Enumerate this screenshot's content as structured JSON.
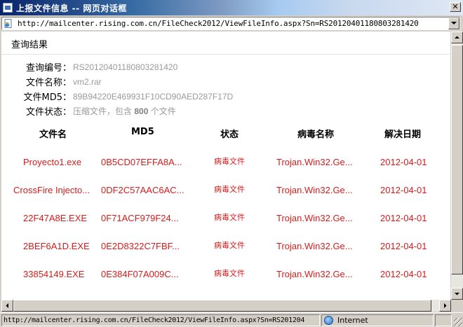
{
  "window": {
    "title": "上报文件信息 -- 网页对话框"
  },
  "address": {
    "url": "http://mailcenter.rising.com.cn/FileCheck2012/ViewFileInfo.aspx?Sn=RS20120401180803281420"
  },
  "page": {
    "section_title": "查询结果",
    "info": [
      {
        "label": "查询编号：",
        "value": "RS20120401180803281420"
      },
      {
        "label": "文件名称：",
        "value": "vm2.rar"
      },
      {
        "label": "文件MD5：",
        "value": "89B94220E469931F10CD90AED287F17D"
      },
      {
        "label": "文件状态：",
        "value_prefix": "压缩文件，包含 ",
        "value_count": "800",
        "value_suffix": " 个文件"
      }
    ],
    "table": {
      "headers": [
        "文件名",
        "MD5",
        "状态",
        "病毒名称",
        "解决日期"
      ],
      "rows": [
        {
          "file": "Proyecto1.exe",
          "md5": "0B5CD07EFFA8A...",
          "status": "病毒文件",
          "virus": "Trojan.Win32.Ge...",
          "date": "2012-04-01"
        },
        {
          "file": "CrossFire Injecto...",
          "md5": "0DF2C57AAC6AC...",
          "status": "病毒文件",
          "virus": "Trojan.Win32.Ge...",
          "date": "2012-04-01"
        },
        {
          "file": "22F47A8E.EXE",
          "md5": "0F71ACF979F24...",
          "status": "病毒文件",
          "virus": "Trojan.Win32.Ge...",
          "date": "2012-04-01"
        },
        {
          "file": "2BEF6A1D.EXE",
          "md5": "0E2D8322C7FBF...",
          "status": "病毒文件",
          "virus": "Trojan.Win32.Ge...",
          "date": "2012-04-01"
        },
        {
          "file": "33854149.EXE",
          "md5": "0E384F07A009C...",
          "status": "病毒文件",
          "virus": "Trojan.Win32.Ge...",
          "date": "2012-04-01"
        }
      ]
    }
  },
  "statusbar": {
    "url": "http://mailcenter.rising.com.cn/FileCheck2012/ViewFileInfo.aspx?Sn=RS201204",
    "zone": "Internet"
  },
  "colors": {
    "row_text": "#d41c1c",
    "info_value": "#9a9a9a",
    "title_bar": "#0a246a"
  },
  "icons": {
    "title": "dialog-page-icon",
    "address": "page-icon",
    "zone": "globe-icon"
  }
}
